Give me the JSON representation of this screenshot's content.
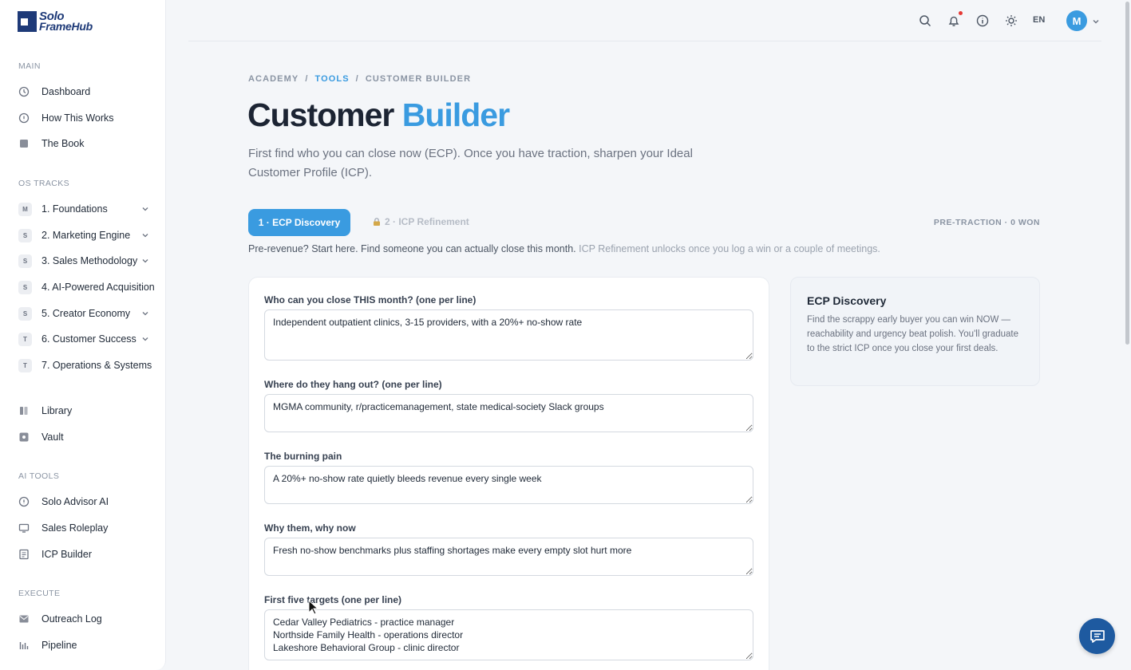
{
  "brand": {
    "line1": "Solo",
    "line2": "FrameHub"
  },
  "sidebar": {
    "main_heading": "MAIN",
    "main": [
      {
        "label": "Dashboard",
        "icon": "clock-icon"
      },
      {
        "label": "How This Works",
        "icon": "info-icon"
      },
      {
        "label": "The Book",
        "icon": "book-icon"
      }
    ],
    "os_heading": "OS TRACKS",
    "tracks": [
      {
        "badge": "M",
        "label": "1. Foundations",
        "expandable": true
      },
      {
        "badge": "S",
        "label": "2. Marketing Engine",
        "expandable": true
      },
      {
        "badge": "S",
        "label": "3. Sales Methodology",
        "expandable": true
      },
      {
        "badge": "S",
        "label": "4. AI-Powered Acquisition",
        "expandable": false
      },
      {
        "badge": "S",
        "label": "5. Creator Economy",
        "expandable": true
      },
      {
        "badge": "T",
        "label": "6. Customer Success",
        "expandable": true
      },
      {
        "badge": "T",
        "label": "7. Operations & Systems",
        "expandable": false
      }
    ],
    "resources": [
      {
        "label": "Library",
        "icon": "library-icon"
      },
      {
        "label": "Vault",
        "icon": "vault-icon"
      }
    ],
    "ai_heading": "AI TOOLS",
    "ai": [
      {
        "label": "Solo Advisor AI",
        "icon": "advisor-icon"
      },
      {
        "label": "Sales Roleplay",
        "icon": "monitor-icon"
      },
      {
        "label": "ICP Builder",
        "icon": "document-icon"
      }
    ],
    "execute_heading": "EXECUTE",
    "execute": [
      {
        "label": "Outreach Log",
        "icon": "mail-icon"
      },
      {
        "label": "Pipeline",
        "icon": "bars-icon"
      }
    ]
  },
  "topbar": {
    "lang": "EN",
    "avatar": "M",
    "notification": true
  },
  "breadcrumb": {
    "root": "ACADEMY",
    "mid": "TOOLS",
    "current": "CUSTOMER BUILDER",
    "sep": "/"
  },
  "title": {
    "main": "Customer",
    "accent": "Builder"
  },
  "subtitle": "First find who you can close now (ECP). Once you have traction, sharpen your Ideal Customer Profile (ICP).",
  "tabs": {
    "active": "1 · ECP Discovery",
    "locked": "2 · ICP Refinement"
  },
  "status": "PRE-TRACTION · 0 WON",
  "info": {
    "main": "Pre-revenue? Start here. Find someone you can actually close this month.",
    "muted": "ICP Refinement unlocks once you log a win or a couple of meetings."
  },
  "form": {
    "fields": [
      {
        "label": "Who can you close THIS month? (one per line)",
        "value": "Independent outpatient clinics, 3-15 providers, with a 20%+ no-show rate"
      },
      {
        "label": "Where do they hang out? (one per line)",
        "value": "MGMA community, r/practicemanagement, state medical-society Slack groups"
      },
      {
        "label": "The burning pain",
        "value": "A 20%+ no-show rate quietly bleeds revenue every single week"
      },
      {
        "label": "Why them, why now",
        "value": "Fresh no-show benchmarks plus staffing shortages make every empty slot hurt more"
      },
      {
        "label": "First five targets (one per line)",
        "value": "Cedar Valley Pediatrics - practice manager\nNorthside Family Health - operations director\nLakeshore Behavioral Group - clinic director"
      }
    ]
  },
  "side_card": {
    "title": "ECP Discovery",
    "body": "Find the scrappy early buyer you can win NOW — reachability and urgency beat polish. You'll graduate to the strict ICP once you close your first deals."
  },
  "colors": {
    "accent": "#3a9be0",
    "brand": "#1e3a78",
    "chat": "#1e5aa0"
  }
}
